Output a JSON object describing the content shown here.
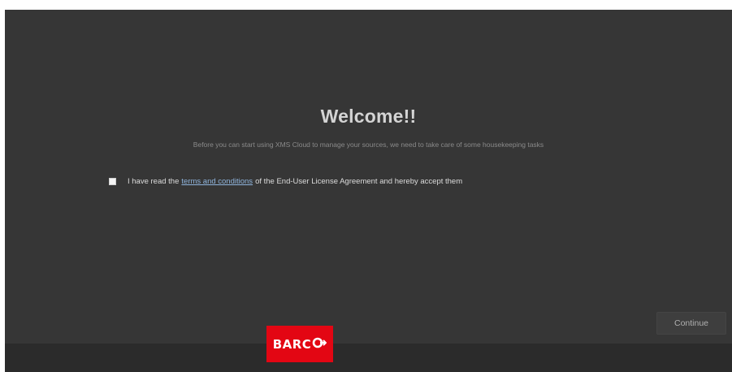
{
  "welcome": {
    "title": "Welcome!!",
    "subtitle": "Before you can start using XMS Cloud to manage your sources, we need to take care of some housekeeping tasks"
  },
  "agreement": {
    "checked": false,
    "text_before": "I have read the",
    "link_text": "terms and conditions",
    "text_after": "of the End-User License Agreement and hereby accept them"
  },
  "actions": {
    "continue_label": "Continue"
  },
  "brand": {
    "logo_text": "BARC",
    "logo_color": "#e30613"
  }
}
